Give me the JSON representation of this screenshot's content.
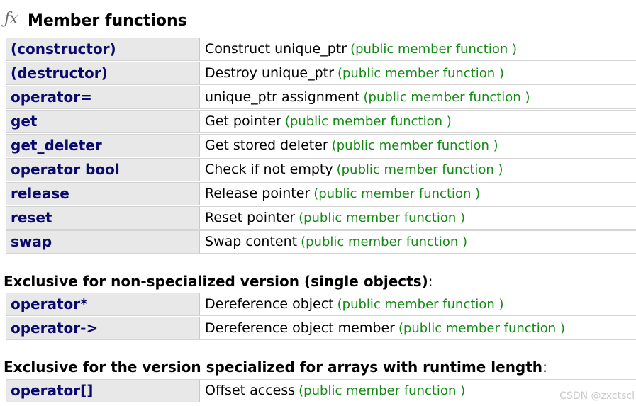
{
  "section": {
    "icon": "fx-icon",
    "title": "Member functions"
  },
  "main_table": {
    "rows": [
      {
        "name": "(constructor)",
        "desc": "Construct unique_ptr",
        "kind": "(public member function )"
      },
      {
        "name": "(destructor)",
        "desc": "Destroy unique_ptr",
        "kind": "(public member function )"
      },
      {
        "name": "operator=",
        "desc": "unique_ptr assignment",
        "kind": "(public member function )"
      },
      {
        "name": "get",
        "desc": "Get pointer",
        "kind": "(public member function )"
      },
      {
        "name": "get_deleter",
        "desc": "Get stored deleter",
        "kind": "(public member function )"
      },
      {
        "name": "operator bool",
        "desc": "Check if not empty",
        "kind": "(public member function )"
      },
      {
        "name": "release",
        "desc": "Release pointer",
        "kind": "(public member function )"
      },
      {
        "name": "reset",
        "desc": "Reset pointer",
        "kind": "(public member function )"
      },
      {
        "name": "swap",
        "desc": "Swap content",
        "kind": "(public member function )"
      }
    ]
  },
  "single_section": {
    "heading": "Exclusive for non-specialized version (single objects)",
    "colon": ":",
    "rows": [
      {
        "name": "operator*",
        "desc": "Dereference object",
        "kind": "(public member function )"
      },
      {
        "name": "operator->",
        "desc": "Dereference object member",
        "kind": "(public member function )"
      }
    ]
  },
  "array_section": {
    "heading": "Exclusive for the version specialized for arrays with runtime length",
    "colon": ":",
    "rows": [
      {
        "name": "operator[]",
        "desc": "Offset access",
        "kind": "(public member function )"
      }
    ]
  },
  "watermark": "CSDN @zxctscl",
  "colors": {
    "link": "#0a0a6e",
    "kind": "#138a13",
    "name_cell_bg": "#e8e8e8"
  }
}
